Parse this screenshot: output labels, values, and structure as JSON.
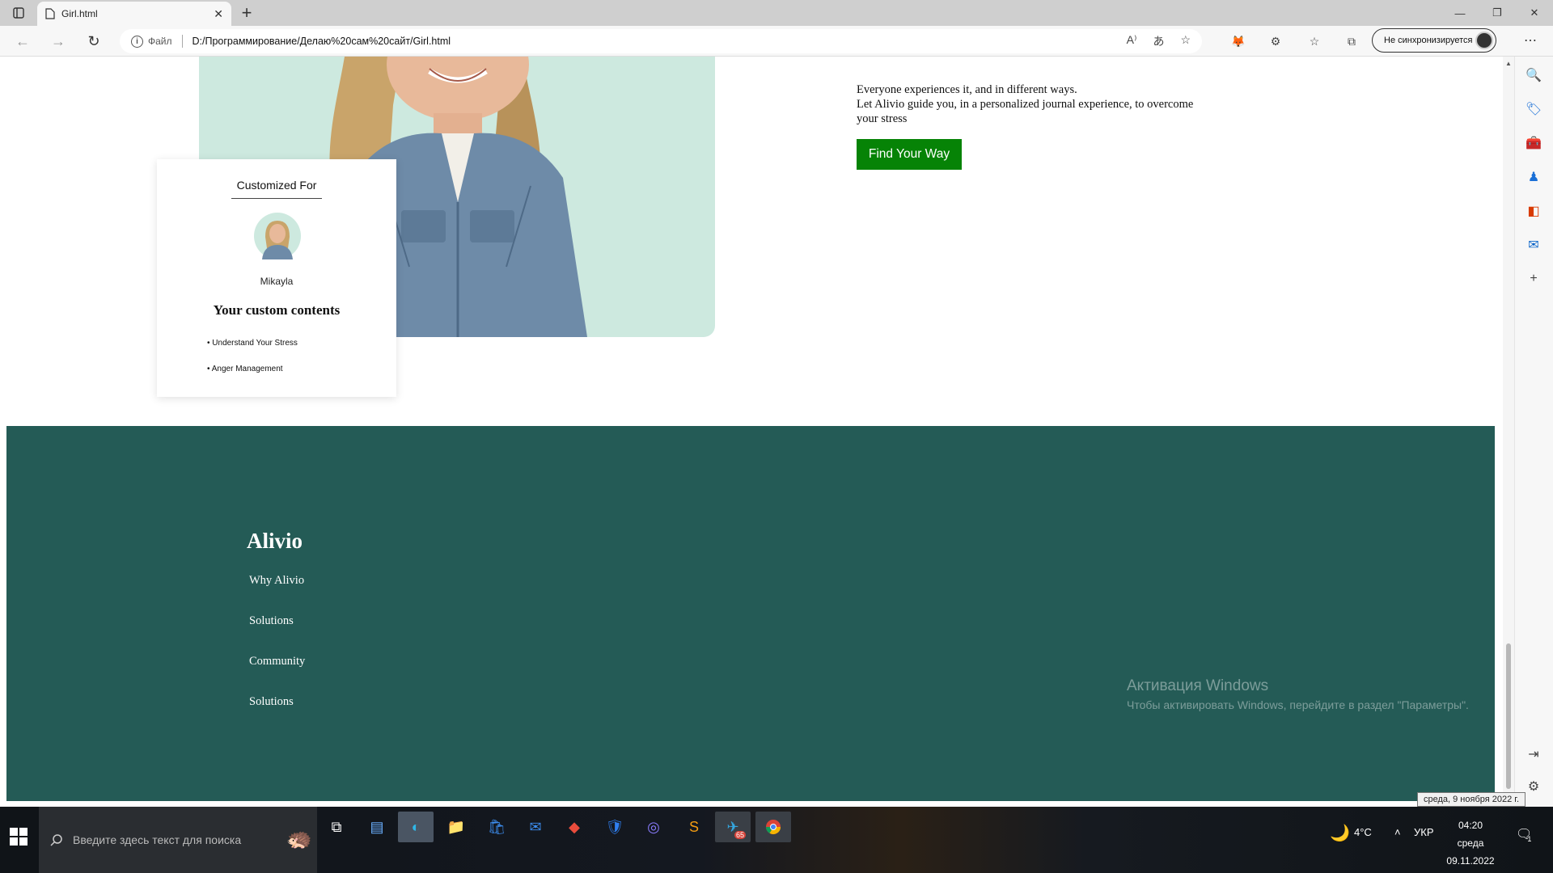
{
  "browser": {
    "tab_title": "Girl.html",
    "file_label": "Файл",
    "url": "D:/Программирование/Делаю%20сам%20сайт/Girl.html",
    "sync_label": "Не синхронизируется"
  },
  "card": {
    "heading": "Customized For",
    "name": "Mikayla",
    "subheading": "Your custom contents",
    "items": [
      "• Understand Your Stress",
      "• Anger Management"
    ]
  },
  "intro": {
    "line1": "Everyone experiences it, and in different ways.",
    "line2": "Let Alivio guide you, in a personalized journal experience, to overcome your stress",
    "cta": "Find Your Way"
  },
  "footer": {
    "brand": "Alivio",
    "links": [
      "Why Alivio",
      "Solutions",
      "Community",
      "Solutions"
    ]
  },
  "activation": {
    "title": "Активация Windows",
    "subtitle": "Чтобы активировать Windows, перейдите в раздел \"Параметры\"."
  },
  "tooltip": "среда, 9 ноября 2022 г.",
  "taskbar": {
    "search_placeholder": "Введите здесь текст для поиска",
    "weather": "4°C",
    "lang": "УКР",
    "time": "04:20",
    "day": "среда",
    "date": "09.11.2022",
    "telegram_badge": "65",
    "notif_count": "1"
  },
  "colors": {
    "footer_bg": "#245b56",
    "cta_bg": "#068306",
    "hero_bg": "#cde9df"
  }
}
